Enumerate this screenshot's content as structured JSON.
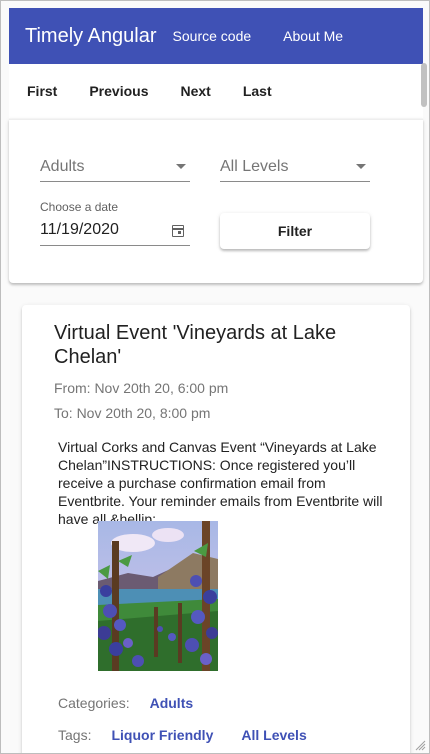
{
  "toolbar": {
    "title": "Timely Angular",
    "links": [
      "Source code",
      "About Me"
    ],
    "color": "#3f51b5"
  },
  "pager": {
    "buttons": [
      "First",
      "Previous",
      "Next",
      "Last"
    ]
  },
  "filters": {
    "category": {
      "value": "Adults",
      "icon": "dropdown-arrow-icon"
    },
    "level": {
      "value": "All Levels",
      "icon": "dropdown-arrow-icon"
    },
    "date": {
      "label": "Choose a date",
      "value": "11/19/2020",
      "icon": "calendar-icon"
    },
    "filter_button": "Filter"
  },
  "event": {
    "title": "Virtual Event 'Vineyards at Lake Chelan'",
    "from": "From: Nov 20th 20, 6:00 pm",
    "to": "To: Nov 20th 20, 8:00 pm",
    "description": "Virtual Corks and Canvas Event “Vineyards at Lake Chelan”INSTRUCTIONS: Once registered you’ll receive a purchase confirmation email from Eventbrite. Your reminder emails from Eventbrite will have all &hellip;",
    "categories_label": "Categories:",
    "categories": [
      "Adults"
    ],
    "tags_label": "Tags:",
    "tags": [
      "Liquor Friendly",
      "All Levels"
    ],
    "link_color": "#3f51b5"
  }
}
